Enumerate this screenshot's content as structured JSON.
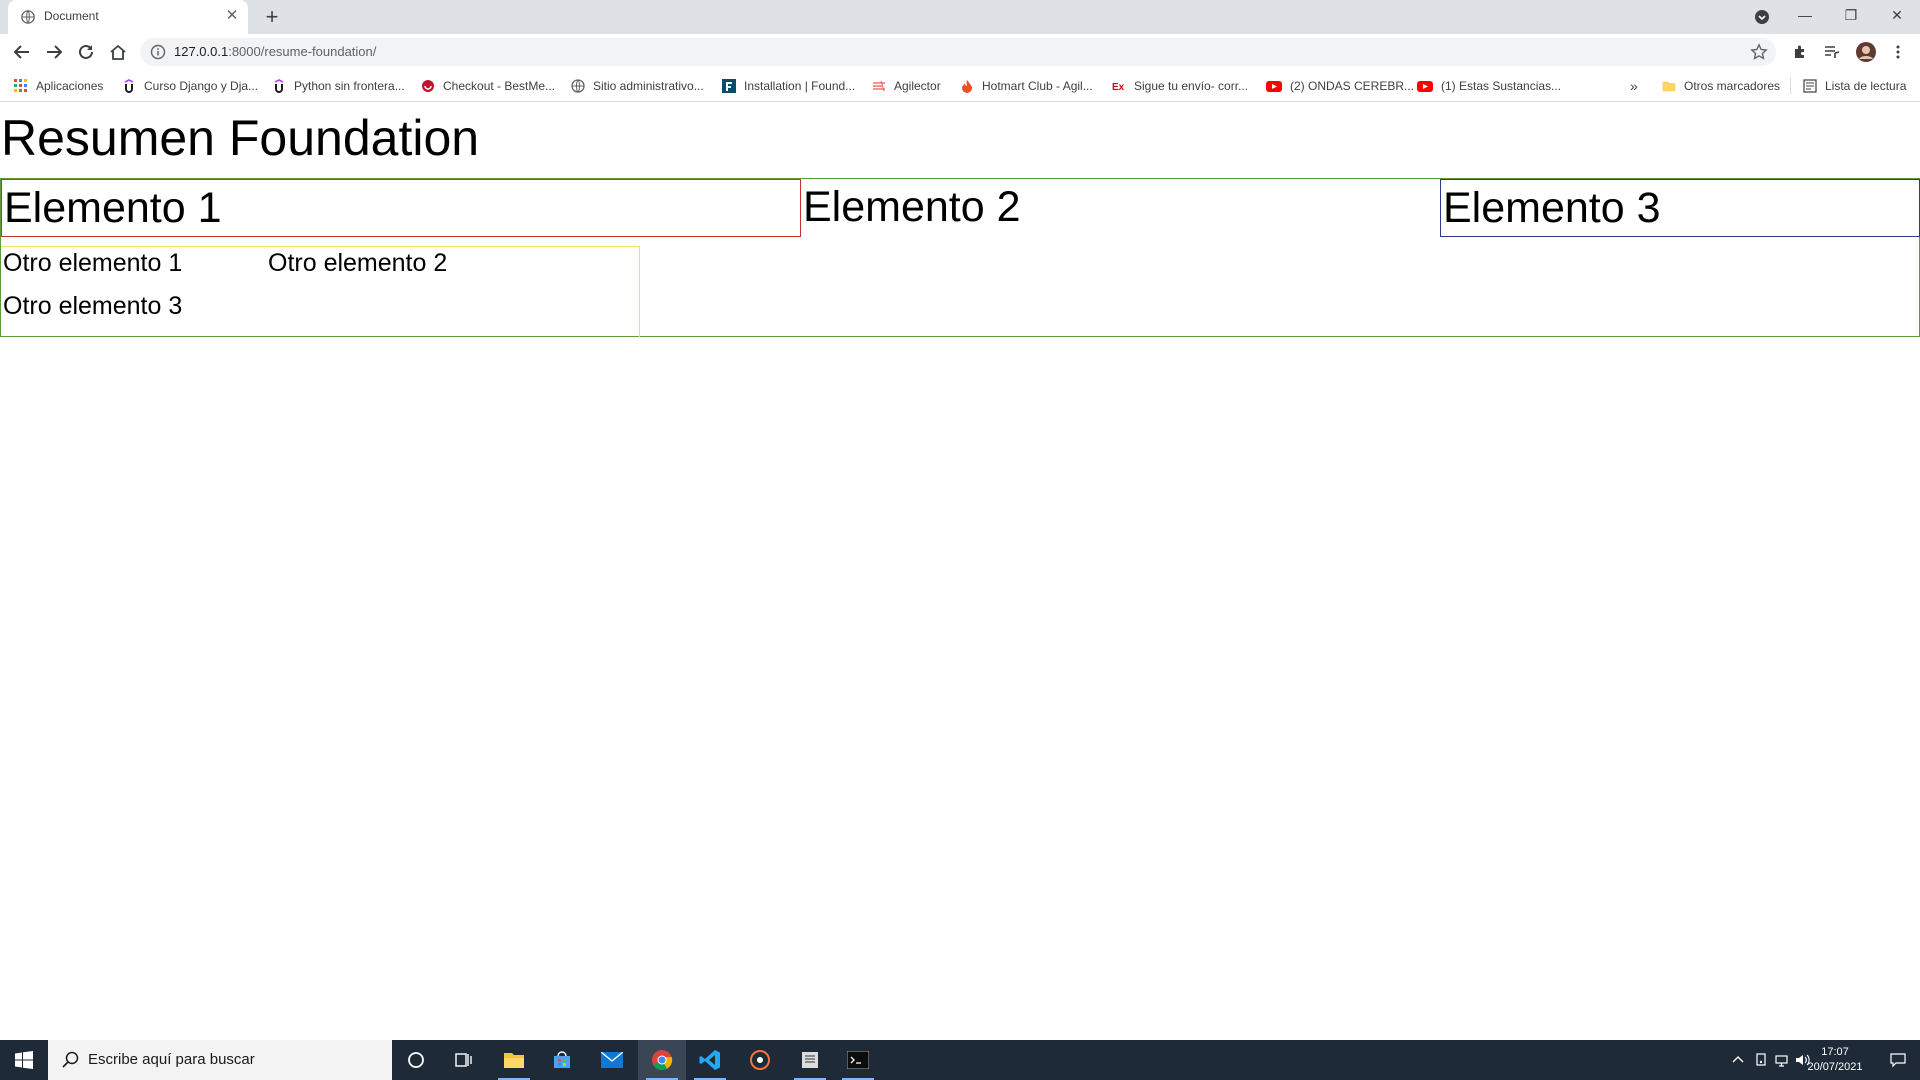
{
  "browser": {
    "tab_title": "Document",
    "new_tab_symbol": "+",
    "url_host": "127.0.0.1",
    "url_path": ":8000/resume-foundation/",
    "window_controls": {
      "minimize": "—",
      "restore": "❐",
      "close": "✕"
    }
  },
  "bookmarks": [
    {
      "label": "Aplicaciones",
      "icon": "apps-grid-icon"
    },
    {
      "label": "Curso Django y Dja...",
      "icon": "udemy-icon"
    },
    {
      "label": "Python sin frontera...",
      "icon": "udemy-icon"
    },
    {
      "label": "Checkout - BestMe...",
      "icon": "bestme-icon"
    },
    {
      "label": "Sitio administrativo...",
      "icon": "globe-icon"
    },
    {
      "label": "Installation | Found...",
      "icon": "foundation-icon"
    },
    {
      "label": "Agilector",
      "icon": "agilector-icon"
    },
    {
      "label": "Hotmart Club - Agil...",
      "icon": "hotmart-icon"
    },
    {
      "label": "Sigue tu envío- corr...",
      "icon": "estafeta-icon"
    },
    {
      "label": "(2) ONDAS CEREBR...",
      "icon": "youtube-icon"
    },
    {
      "label": "(1) Estas Sustancias...",
      "icon": "youtube-icon"
    }
  ],
  "bookmarks_overflow": "»",
  "bookmarks_right": {
    "other": "Otros marcadores",
    "reading_list": "Lista de lectura"
  },
  "page": {
    "title": "Resumen Foundation",
    "elements": [
      "Elemento 1",
      "Elemento 2",
      "Elemento 3"
    ],
    "sub_elements": [
      "Otro elemento 1",
      "Otro elemento 2",
      "Otro elemento 3"
    ]
  },
  "taskbar": {
    "search_placeholder": "Escribe aquí para buscar",
    "time": "17:07",
    "date": "20/07/2021",
    "apps": [
      "cortana-icon",
      "task-view-icon",
      "file-explorer-icon",
      "store-icon",
      "mail-icon",
      "chrome-icon",
      "vscode-icon",
      "media-player-icon",
      "files-icon",
      "terminal-icon"
    ]
  },
  "colors": {
    "accent": "#1a73e8",
    "border_row": "#5e9b3a",
    "border_el1": "#c53030",
    "border_el3": "#2b3a8c",
    "border_sub": "#f0e35a",
    "taskbar": "#1f2a38"
  }
}
